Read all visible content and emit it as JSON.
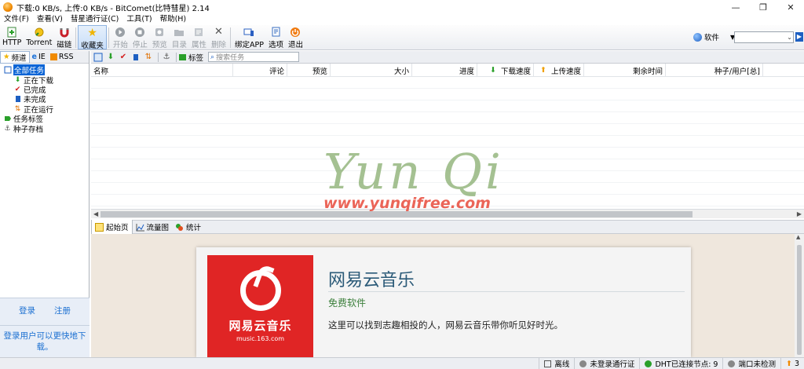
{
  "window": {
    "title": "下载:0 KB/s, 上传:0 KB/s - BitComet(比特彗星) 2.14",
    "minimize": "—",
    "maximize": "❐",
    "close": "✕"
  },
  "menu": [
    "文件(F)",
    "查看(V)",
    "彗星通行证(C)",
    "工具(T)",
    "帮助(H)"
  ],
  "toolbar": [
    {
      "label": "HTTP",
      "icon": "http-icon",
      "enabled": true
    },
    {
      "label": "Torrent",
      "icon": "torrent-icon",
      "enabled": true
    },
    {
      "label": "磁链",
      "icon": "magnet-icon",
      "enabled": true
    },
    {
      "label": "收藏夹",
      "icon": "star-icon",
      "enabled": true,
      "active": true
    },
    {
      "label": "开始",
      "icon": "play-icon",
      "enabled": false
    },
    {
      "label": "停止",
      "icon": "stop-icon",
      "enabled": false
    },
    {
      "label": "预览",
      "icon": "preview-icon",
      "enabled": false
    },
    {
      "label": "目录",
      "icon": "folder-icon",
      "enabled": false
    },
    {
      "label": "属性",
      "icon": "properties-icon",
      "enabled": false
    },
    {
      "label": "删除",
      "icon": "delete-icon",
      "enabled": false
    },
    {
      "label": "绑定APP",
      "icon": "bind-app-icon",
      "enabled": true
    },
    {
      "label": "选项",
      "icon": "options-icon",
      "enabled": true
    },
    {
      "label": "退出",
      "icon": "exit-icon",
      "enabled": true
    }
  ],
  "search": {
    "scope": "软件",
    "value": ""
  },
  "left_tabs": [
    "频道",
    "IE",
    "RSS"
  ],
  "tree": [
    {
      "label": "全部任务",
      "selected": true,
      "level": 0
    },
    {
      "label": "正在下载",
      "level": 1
    },
    {
      "label": "已完成",
      "level": 1
    },
    {
      "label": "未完成",
      "level": 1
    },
    {
      "label": "正在运行",
      "level": 1
    },
    {
      "label": "任务标签",
      "level": 0
    },
    {
      "label": "种子存档",
      "level": 0
    }
  ],
  "login": {
    "login": "登录",
    "register": "注册",
    "tip": "登录用户可以更快地下载。"
  },
  "subtoolbar": {
    "tag": "标签",
    "search_placeholder": "搜索任务"
  },
  "columns": [
    {
      "label": "名称"
    },
    {
      "label": "评论"
    },
    {
      "label": "预览"
    },
    {
      "label": "大小"
    },
    {
      "label": "进度"
    },
    {
      "label": "下载速度"
    },
    {
      "label": "上传速度"
    },
    {
      "label": "剩余时间"
    },
    {
      "label": "种子/用户[总]"
    }
  ],
  "bottom_tabs": [
    "起始页",
    "流量图",
    "统计"
  ],
  "start_page": {
    "logo_text": "网易云音乐",
    "logo_url": "music.163.com",
    "title": "网易云音乐",
    "category": "免费软件",
    "description": "这里可以找到志趣相投的人，网易云音乐带你听见好时光。"
  },
  "watermark": {
    "script": "Yun Qi",
    "url": "www.yunqifree.com"
  },
  "status": {
    "offline": "离线",
    "passport": "未登录通行证",
    "dht": "DHT已连接节点: 9",
    "port": "端口未检测",
    "count": "3"
  },
  "colors": {
    "accent": "#0a64d6",
    "logo_red": "#e02525",
    "link_blue": "#1a6fd1"
  }
}
